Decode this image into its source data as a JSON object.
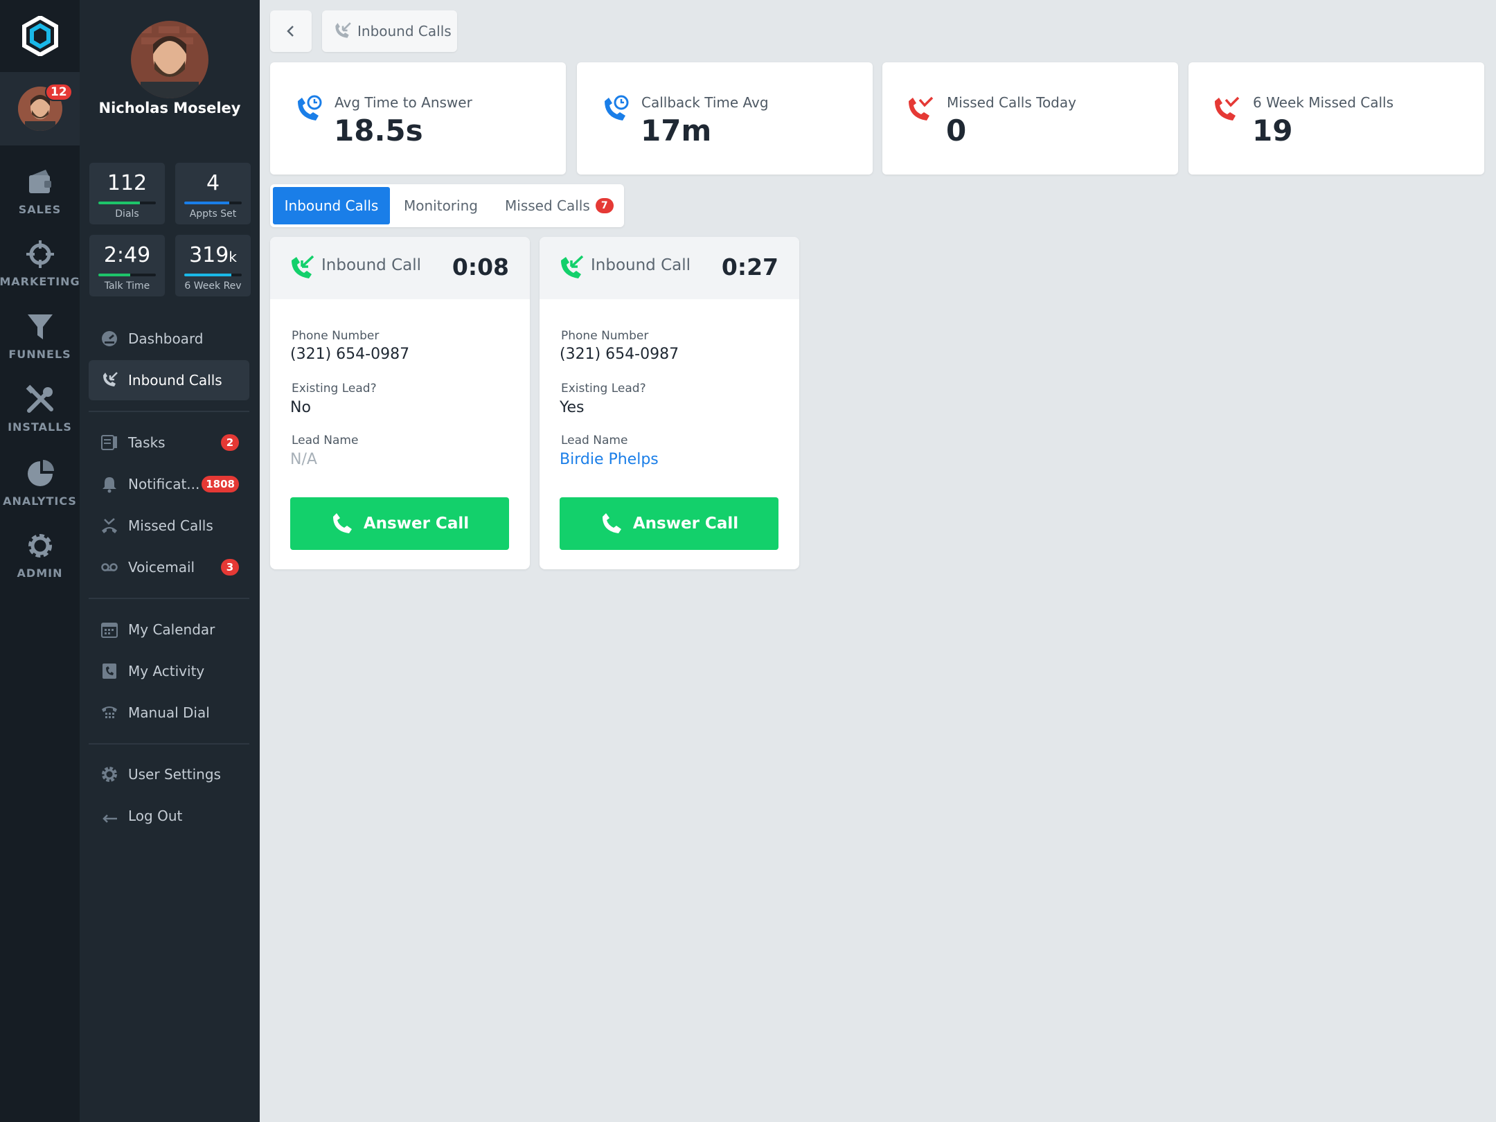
{
  "rail": {
    "notification_count": "12",
    "items": [
      {
        "label": "SALES",
        "icon": "wallet-icon"
      },
      {
        "label": "MARKETING",
        "icon": "crosshair-icon"
      },
      {
        "label": "FUNNELS",
        "icon": "funnel-icon"
      },
      {
        "label": "INSTALLS",
        "icon": "tools-icon"
      },
      {
        "label": "ANALYTICS",
        "icon": "pie-chart-icon"
      },
      {
        "label": "ADMIN",
        "icon": "gear-icon"
      }
    ]
  },
  "profile": {
    "name": "Nicholas Moseley"
  },
  "stats": [
    {
      "value": "112",
      "label": "Dials",
      "progress": 0.72,
      "color": "#1ec46a"
    },
    {
      "value": "4",
      "label": "Appts Set",
      "progress": 0.78,
      "color": "#1a7ee8"
    },
    {
      "value": "2:49",
      "label": "Talk Time",
      "progress": 0.55,
      "color": "#1ec46a"
    },
    {
      "value": "319",
      "unit": "k",
      "label": "6 Week Rev",
      "progress": 0.82,
      "color": "#1ab8e8"
    }
  ],
  "nav": {
    "dashboard": "Dashboard",
    "inbound_calls": "Inbound Calls",
    "tasks": "Tasks",
    "tasks_badge": "2",
    "notifications": "Notificat...",
    "notifications_badge": "1808",
    "missed_calls": "Missed Calls",
    "voicemail": "Voicemail",
    "voicemail_badge": "3",
    "my_calendar": "My Calendar",
    "my_activity": "My Activity",
    "manual_dial": "Manual Dial",
    "user_settings": "User Settings",
    "log_out": "Log Out"
  },
  "breadcrumb": {
    "label": "Inbound Calls"
  },
  "kpis": [
    {
      "label": "Avg Time to Answer",
      "value": "18.5s",
      "icon": "phone-clock-icon",
      "color": "#1a7ee8"
    },
    {
      "label": "Callback Time Avg",
      "value": "17m",
      "icon": "phone-clock-icon",
      "color": "#1a7ee8"
    },
    {
      "label": "Missed Calls Today",
      "value": "0",
      "icon": "missed-call-icon",
      "color": "#e53935"
    },
    {
      "label": "6 Week Missed Calls",
      "value": "19",
      "icon": "missed-call-icon",
      "color": "#e53935"
    }
  ],
  "tabs": {
    "inbound": "Inbound Calls",
    "monitoring": "Monitoring",
    "missed": "Missed Calls",
    "missed_badge": "7"
  },
  "calls": [
    {
      "title": "Inbound Call",
      "timer": "0:08",
      "phone_label": "Phone Number",
      "phone": "(321) 654-0987",
      "existing_label": "Existing Lead?",
      "existing": "No",
      "lead_label": "Lead Name",
      "lead": "N/A",
      "button": "Answer Call"
    },
    {
      "title": "Inbound Call",
      "timer": "0:27",
      "phone_label": "Phone Number",
      "phone": "(321) 654-0987",
      "existing_label": "Existing Lead?",
      "existing": "Yes",
      "lead_label": "Lead Name",
      "lead": "Birdie Phelps",
      "button": "Answer Call"
    }
  ],
  "colors": {
    "accent": "#1a7ee8",
    "success": "#13d06b",
    "danger": "#e53935"
  }
}
